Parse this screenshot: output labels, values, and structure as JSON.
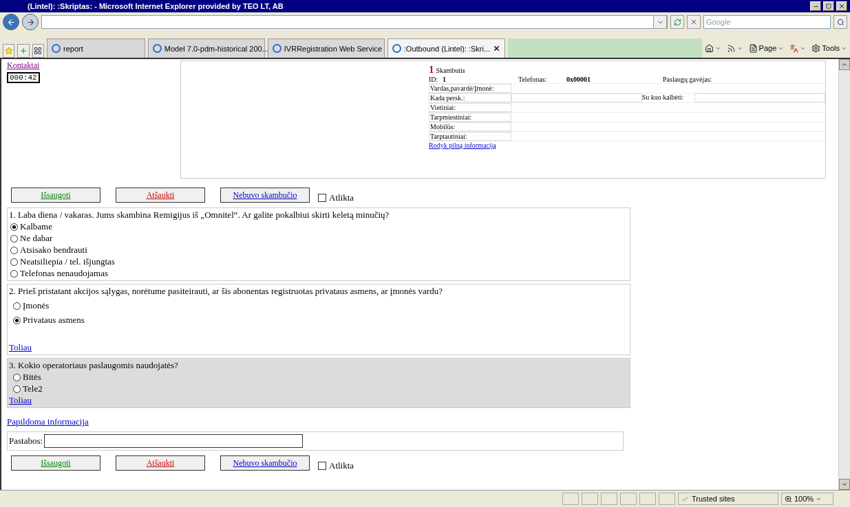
{
  "window": {
    "title": "(Lintel): :Skriptas: - Microsoft Internet Explorer provided by TEO LT, AB"
  },
  "address_bar": {
    "search_placeholder": "Google"
  },
  "tabs": [
    {
      "label": "report",
      "selected": false
    },
    {
      "label": "Model 7.0-pdm-historical 200...",
      "selected": false
    },
    {
      "label": "IVRRegistration Web Service",
      "selected": false
    },
    {
      "label": ":Outbound (Lintel): :Skri...",
      "selected": true
    }
  ],
  "command_bar": {
    "page": "Page",
    "tools": "Tools"
  },
  "sidebar": {
    "link": "Kontaktai",
    "timer": "000:42"
  },
  "call_info": {
    "number": "1",
    "title": "Skambutis",
    "id_label": "ID:",
    "id": "1",
    "phone_label": "Telefonas:",
    "phone": "0x00001",
    "provider_label": "Paslaugų gavėjas:",
    "fields": [
      {
        "label": "Vardas,pavardė/Įmonė:"
      },
      {
        "label": "Kada persk.:",
        "extra_label": "Su kuo kalbėti:"
      },
      {
        "label": "Vietiniai:"
      },
      {
        "label": "Tarpmiestiniai:"
      },
      {
        "label": "Mobilūs:"
      },
      {
        "label": "Tarptautiniai:"
      }
    ],
    "link": "Rodyk pilną informaciją"
  },
  "actions_top": {
    "buttons": [
      {
        "label": "Išsaugoti",
        "kind": "save"
      },
      {
        "label": "Atšaukti",
        "kind": "cancel"
      },
      {
        "label": "Nebuvo skambučio",
        "kind": "nocall"
      }
    ],
    "checkbox": {
      "label": "Atlikta",
      "checked": false
    }
  },
  "questions": [
    {
      "text": "1. Laba diena / vakaras. Jums skambina Remigijus iš „Omnitel“. Ar galite pokalbiui skirti keletą minučių?",
      "active": false,
      "options": [
        {
          "label": "Kalbame",
          "selected": true
        },
        {
          "label": "Ne dabar",
          "selected": false
        },
        {
          "label": "Atsisako bendrauti",
          "selected": false
        },
        {
          "label": "Neatsiliepia / tel. išjungtas",
          "selected": false
        },
        {
          "label": "Telefonas nenaudojamas",
          "selected": false
        }
      ]
    },
    {
      "text": "2. Prieš pristatant akcijos sąlygas, norėtume pasiteirauti, ar šis abonentas registruotas privataus asmens, ar įmonės vardu?",
      "active": false,
      "options": [
        {
          "label": "Įmonės",
          "selected": false
        },
        {
          "label": "Privataus asmens",
          "selected": true
        }
      ],
      "next": "Toliau"
    },
    {
      "text": "3. Kokio operatoriaus paslaugomis naudojatės?",
      "active": true,
      "options": [
        {
          "label": "Bitės",
          "selected": false
        },
        {
          "label": "Tele2",
          "selected": false
        }
      ],
      "next": "Toliau"
    }
  ],
  "extra_link": "Papildoma informacija",
  "notes": {
    "label": "Pastabos:"
  },
  "actions_bottom": {
    "buttons": [
      {
        "label": "Išsaugoti",
        "kind": "save"
      },
      {
        "label": "Atšaukti",
        "kind": "cancel"
      },
      {
        "label": "Nebuvo skambučio",
        "kind": "nocall"
      }
    ],
    "checkbox": {
      "label": "Atlikta",
      "checked": false
    }
  },
  "status_bar": {
    "zone": "Trusted sites",
    "zoom": "100%"
  }
}
